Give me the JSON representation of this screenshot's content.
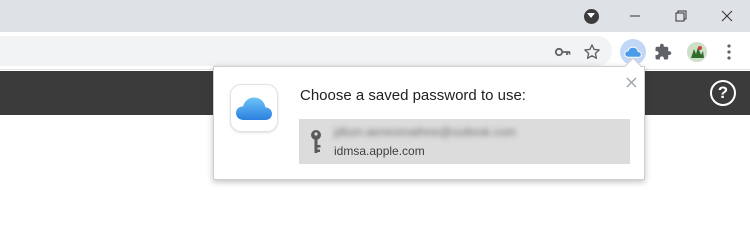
{
  "browser": {
    "window_controls": {
      "profile_icon": "profile-dropdown-icon",
      "minimize_icon": "minimize-icon",
      "restore_icon": "restore-icon",
      "close_icon": "close-icon"
    },
    "toolbar": {
      "icons": [
        "key-icon",
        "star-icon",
        "icloud-extension-icon",
        "puzzle-icon",
        "avatar",
        "kebab-menu-icon"
      ]
    }
  },
  "page": {
    "header_color": "#3b3b3b",
    "help_label": "?"
  },
  "popup": {
    "title": "Choose a saved password to use:",
    "app_icon": "icloud-icon",
    "credential": {
      "username": "jdlum.aeneomathne@outlook.com",
      "site": "idmsa.apple.com",
      "blurred": true
    }
  },
  "colors": {
    "accent_blue": "#3d8ff0",
    "credential_bg": "#dcdcdc"
  }
}
